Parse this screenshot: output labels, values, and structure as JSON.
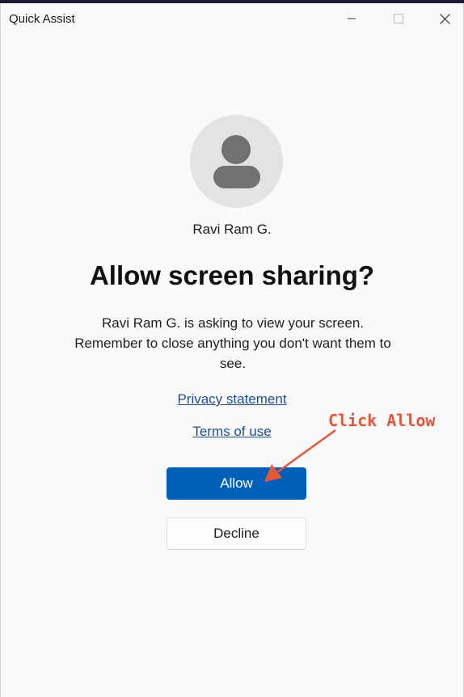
{
  "window": {
    "title": "Quick Assist"
  },
  "dialog": {
    "user_name": "Ravi Ram G.",
    "heading": "Allow screen sharing?",
    "description": "Ravi Ram G. is asking to view your screen. Remember to close anything you don't want them to see.",
    "privacy_link": "Privacy statement",
    "terms_link": "Terms of use",
    "allow_label": "Allow",
    "decline_label": "Decline"
  },
  "annotation": {
    "text": "Click Allow",
    "color": "#e2573a"
  },
  "colors": {
    "accent": "#005fb8",
    "link": "#1f4e8c"
  },
  "icons": [
    "minimize-icon",
    "maximize-icon",
    "close-icon",
    "person-icon",
    "arrow-icon"
  ]
}
